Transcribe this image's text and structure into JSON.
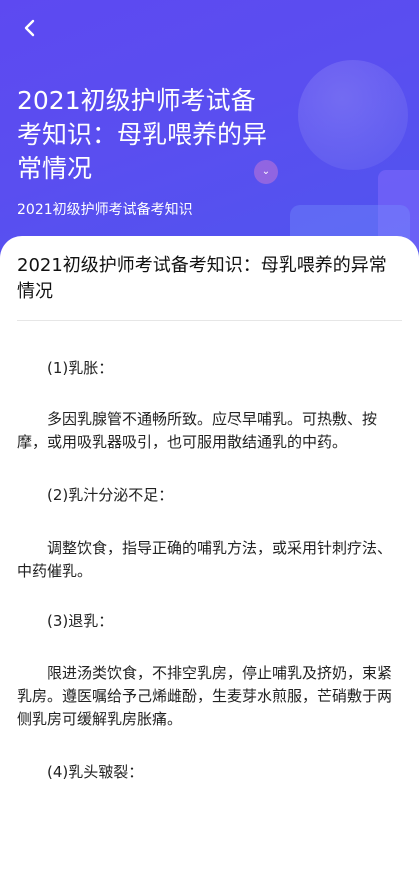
{
  "header": {
    "back_icon": "chevron-left-icon",
    "title": "2021初级护师考试备考知识：母乳喂养的异常情况",
    "subtitle": "2021初级护师考试备考知识",
    "accent_color": "#5a4ef0"
  },
  "article": {
    "title": "2021初级护师考试备考知识：母乳喂养的异常情况",
    "paragraphs": [
      "(1)乳胀：",
      "多因乳腺管不通畅所致。应尽早哺乳。可热敷、按摩，或用吸乳器吸引，也可服用散结通乳的中药。",
      "(2)乳汁分泌不足：",
      "调整饮食，指导正确的哺乳方法，或采用针刺疗法、中药催乳。",
      "(3)退乳：",
      "限进汤类饮食，不排空乳房，停止哺乳及挤奶，束紧乳房。遵医嘱给予己烯雌酚，生麦芽水煎服，芒硝敷于两侧乳房可缓解乳房胀痛。",
      "(4)乳头皲裂："
    ]
  }
}
